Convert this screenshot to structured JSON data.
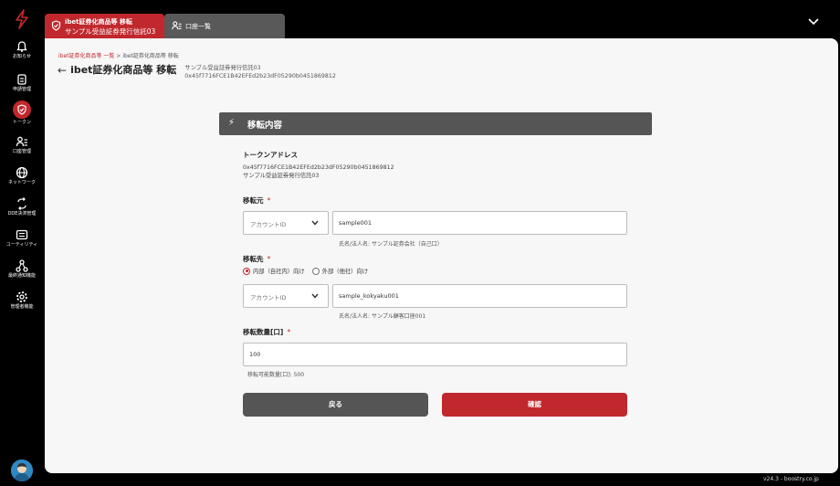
{
  "sidebar": {
    "items": [
      {
        "label": "お知らせ",
        "icon": "bell-icon"
      },
      {
        "label": "申請管理",
        "icon": "clipboard-icon"
      },
      {
        "label": "トークン",
        "icon": "shield-icon"
      },
      {
        "label": "口座管理",
        "icon": "account-list-icon"
      },
      {
        "label": "ネットワーク",
        "icon": "globe-icon"
      },
      {
        "label": "DDE決済管理",
        "icon": "exchange-icon"
      },
      {
        "label": "ユーティリティ",
        "icon": "keyboard-icon"
      },
      {
        "label": "最終通知機能",
        "icon": "nodes-icon"
      },
      {
        "label": "管理者機能",
        "icon": "gear-icon"
      }
    ],
    "active_index": 2,
    "accent": "#c0282d"
  },
  "tabs": {
    "active": {
      "title": "ibet証券化商品等 移転",
      "subtitle": "サンプル受益証券発行信託03"
    },
    "inactive": {
      "title": "口座一覧"
    }
  },
  "breadcrumb": {
    "link": "ibet証券化商品等 一覧",
    "separator": ">",
    "current": "ibet証券化商品等 移転"
  },
  "page": {
    "title": "ibet証券化商品等 移転",
    "sub_name": "サンプル受益証券発行信託03",
    "sub_address": "0x45f7716FCE1B42EFEd2b23dF05290b0451869812"
  },
  "panel": {
    "title": "移転内容"
  },
  "token": {
    "label": "トークンアドレス",
    "address": "0x45f7716FCE1B42EFEd2b23dF05290b0451869812",
    "name": "サンプル受益証券発行信託03"
  },
  "from": {
    "label": "移転元",
    "required_mark": "*",
    "select_value": "アカウントID",
    "input_value": "sample001",
    "hint": "氏名/法人名: サンプル証券会社（自己口）"
  },
  "to": {
    "label": "移転先",
    "required_mark": "*",
    "radio_internal": "内部（自社内）向け",
    "radio_external": "外部（他社）向け",
    "selected": "internal",
    "select_value": "アカウントID",
    "input_value": "sample_kokyaku001",
    "hint": "氏名/法人名: サンプル顧客口座001"
  },
  "quantity": {
    "label": "移転数量[口]",
    "required_mark": "*",
    "input_value": "100",
    "hint": "移転可能数量[口]: 500"
  },
  "buttons": {
    "back": "戻る",
    "confirm": "確認"
  },
  "footer": {
    "version": "v24.3 - boostry.co.jp"
  }
}
